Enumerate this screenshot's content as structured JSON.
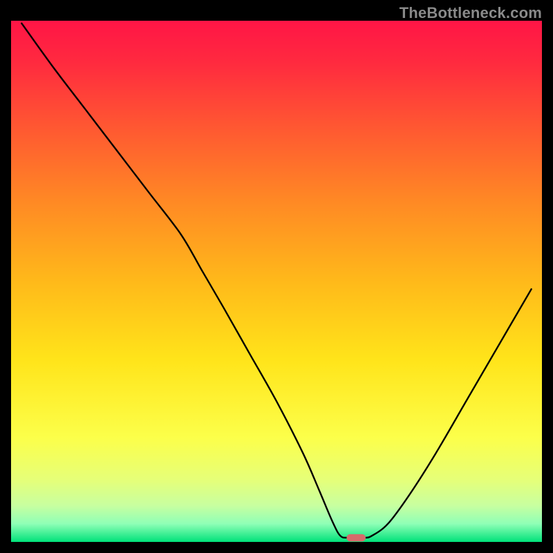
{
  "watermark": "TheBottleneck.com",
  "chart_data": {
    "type": "line",
    "title": "",
    "xlabel": "",
    "ylabel": "",
    "xlim": [
      0,
      100
    ],
    "ylim": [
      0,
      100
    ],
    "grid": false,
    "legend": false,
    "gradient_stops": [
      {
        "offset": 0.0,
        "color": "#ff1546"
      },
      {
        "offset": 0.08,
        "color": "#ff2a3f"
      },
      {
        "offset": 0.2,
        "color": "#ff5632"
      },
      {
        "offset": 0.35,
        "color": "#ff8a24"
      },
      {
        "offset": 0.5,
        "color": "#ffb91a"
      },
      {
        "offset": 0.65,
        "color": "#ffe41a"
      },
      {
        "offset": 0.8,
        "color": "#fcff4a"
      },
      {
        "offset": 0.88,
        "color": "#e6ff78"
      },
      {
        "offset": 0.93,
        "color": "#c8ffa0"
      },
      {
        "offset": 0.965,
        "color": "#8fffb6"
      },
      {
        "offset": 1.0,
        "color": "#00e27a"
      }
    ],
    "series": [
      {
        "name": "bottleneck-curve",
        "x": [
          2.0,
          8.0,
          14.0,
          20.0,
          26.0,
          32.0,
          36.0,
          40.0,
          45.0,
          50.0,
          55.0,
          58.0,
          60.5,
          62.0,
          63.5,
          66.5,
          68.0,
          71.0,
          75.0,
          80.0,
          86.0,
          92.0,
          98.0
        ],
        "values": [
          99.5,
          91.0,
          83.0,
          75.0,
          67.0,
          59.0,
          52.0,
          45.0,
          36.0,
          27.0,
          17.0,
          10.0,
          4.0,
          1.2,
          0.8,
          0.8,
          1.2,
          3.5,
          9.0,
          17.0,
          27.5,
          38.0,
          48.5
        ]
      }
    ],
    "marker": {
      "name": "optimal-point",
      "x": 65.0,
      "y": 0.8,
      "width_x": 3.6,
      "height_y": 1.4,
      "color": "#d66b6b"
    }
  }
}
